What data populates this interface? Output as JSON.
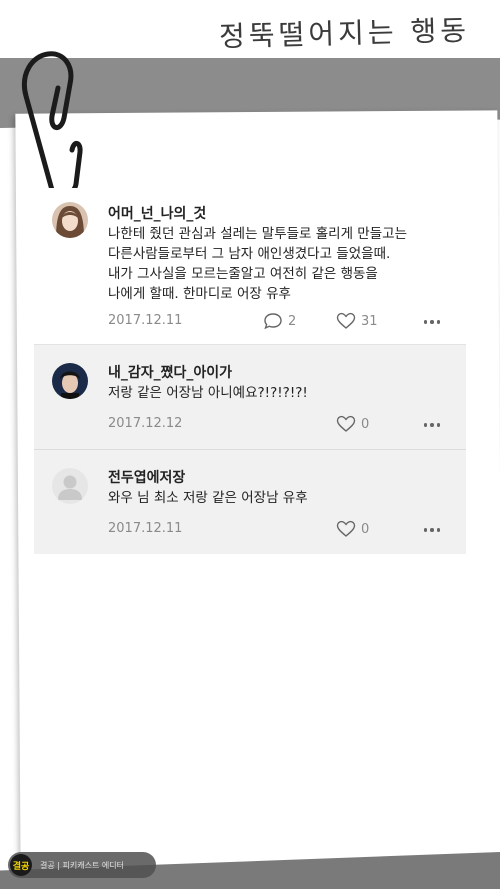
{
  "page": {
    "title": "정뚝떨어지는 행동"
  },
  "comments": [
    {
      "author": "어머_넌_나의_것",
      "text": "나한테 줬던 관심과 설레는 말투들로 홀리게 만들고는\n다른사람들로부터 그 남자 애인생겼다고 들었을때.\n내가 그사실을 모르는줄알고 여전히 같은 행동을\n나에게 할때. 한마디로 어장 유후",
      "date": "2017.12.11",
      "reply_count": "2",
      "like_count": "31"
    },
    {
      "author": "내_감자_쪘다_아이가",
      "text": "저랑 같은 어장남 아니예요?!?!?!?!",
      "date": "2017.12.12",
      "like_count": "0"
    },
    {
      "author": "전두엽에저장",
      "text": "와우 님 최소 저랑 같은 어장남 유후",
      "date": "2017.12.11",
      "like_count": "0"
    }
  ],
  "watermark": {
    "logo": "결공",
    "text": "결공 | 피키캐스트 에디터"
  }
}
